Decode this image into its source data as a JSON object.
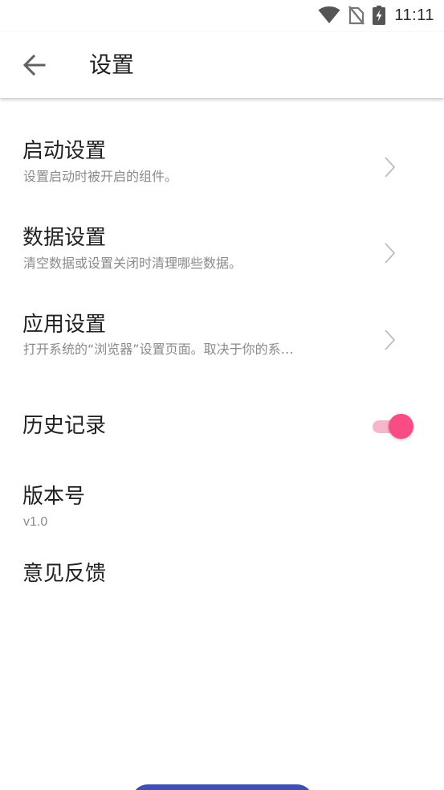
{
  "status_bar": {
    "time": "11:11",
    "icons": [
      "wifi-icon",
      "no-sim-icon",
      "battery-charging-icon"
    ]
  },
  "app_bar": {
    "back_icon": "arrow-left-icon",
    "title": "设置"
  },
  "settings": {
    "startup": {
      "title": "启动设置",
      "subtitle": "设置启动时被开启的组件。"
    },
    "data": {
      "title": "数据设置",
      "subtitle": "清空数据或设置关闭时清理哪些数据。"
    },
    "app": {
      "title": "应用设置",
      "subtitle": "打开系统的“浏览器”设置页面。取决于你的系…"
    },
    "history": {
      "title": "历史记录",
      "enabled": true
    },
    "version": {
      "title": "版本号",
      "value": "v1.0"
    },
    "feedback": {
      "title": "意见反馈"
    }
  },
  "colors": {
    "accent": "#f94c84",
    "accent_track": "#f7b7ca",
    "bottom_button": "#3f4fb3",
    "text_primary": "#212121",
    "text_secondary": "#8a8a8a"
  }
}
